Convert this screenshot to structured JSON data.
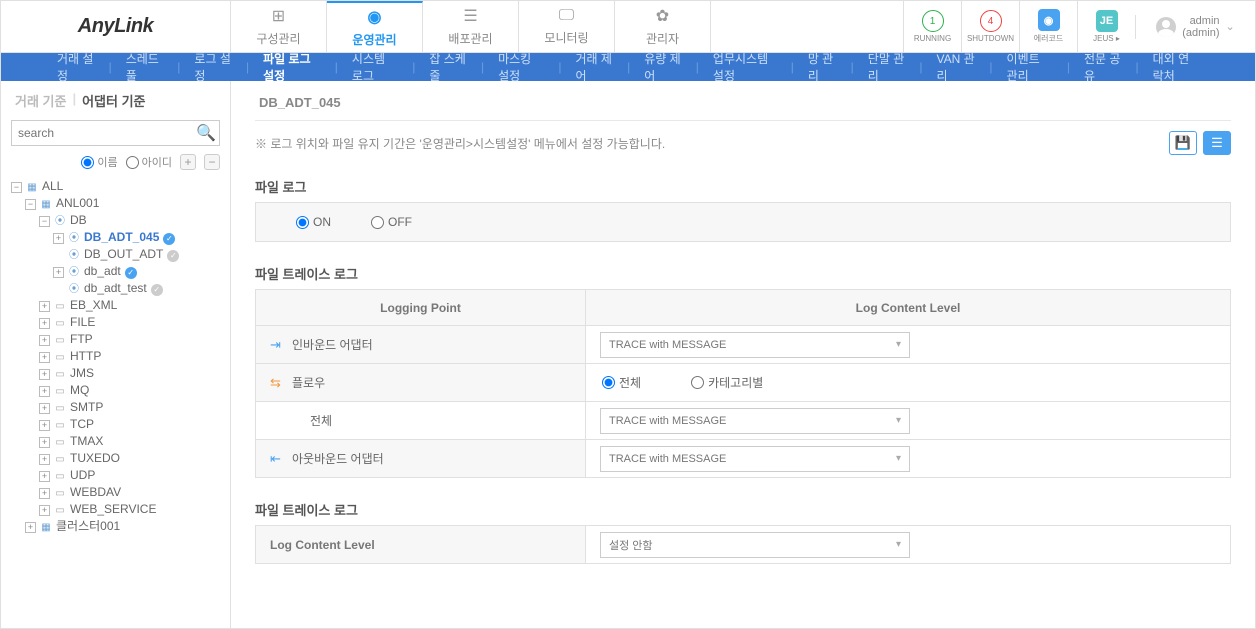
{
  "logo": "AnyLink",
  "topnav": [
    {
      "icon": "⊞",
      "label": "구성관리"
    },
    {
      "icon": "◉",
      "label": "운영관리"
    },
    {
      "icon": "☰",
      "label": "배포관리"
    },
    {
      "icon": "🖵",
      "label": "모니터링"
    },
    {
      "icon": "✿",
      "label": "관리자"
    }
  ],
  "status": {
    "running": {
      "count": "1",
      "label": "RUNNING"
    },
    "shutdown": {
      "count": "4",
      "label": "SHUTDOWN"
    },
    "errcode": {
      "badge": "◉",
      "label": "에러코드"
    },
    "jeus": {
      "badge": "JE",
      "label": "JEUS ▸"
    }
  },
  "user": {
    "name": "admin",
    "sub": "(admin)"
  },
  "subnav": [
    "거래 설정",
    "스레드 풀",
    "로그 설정",
    "파일 로그 설정",
    "시스템 로그",
    "잡 스케줄",
    "마스킹 설정",
    "거래 제어",
    "유량 제어",
    "업무시스템 설정",
    "망 관리",
    "단말 관리",
    "VAN 관리",
    "이벤트 관리",
    "전문 공유",
    "대외 연락처"
  ],
  "subnav_active": 3,
  "sidetabs": {
    "left": "거래 기준",
    "right": "어댑터 기준"
  },
  "search_placeholder": "search",
  "side_radios": {
    "name": "이름",
    "id": "아이디"
  },
  "tree": {
    "root": "ALL",
    "l1": "ANL001",
    "db": "DB",
    "db_children": [
      {
        "label": "DB_ADT_045",
        "check": "blue"
      },
      {
        "label": "DB_OUT_ADT",
        "check": "gray"
      },
      {
        "label": "db_adt",
        "check": "blue"
      },
      {
        "label": "db_adt_test",
        "check": "gray"
      }
    ],
    "others": [
      "EB_XML",
      "FILE",
      "FTP",
      "HTTP",
      "JMS",
      "MQ",
      "SMTP",
      "TCP",
      "TMAX",
      "TUXEDO",
      "UDP",
      "WEBDAV",
      "WEB_SERVICE"
    ],
    "cluster": "클러스터001"
  },
  "breadcrumb": "DB_ADT_045",
  "note": "※ 로그 위치와 파일 유지 기간은 '운영관리>시스템설정' 메뉴에서 설정 가능합니다.",
  "sections": {
    "filelog": {
      "title": "파일 로그",
      "on": "ON",
      "off": "OFF"
    },
    "trace": {
      "title": "파일 트레이스 로그",
      "col1": "Logging Point",
      "col2": "Log Content Level",
      "row_inbound": "인바운드 어댑터",
      "row_flow": "플로우",
      "flow_radio_all": "전체",
      "flow_radio_cat": "카테고리별",
      "row_flow_sub": "전체",
      "row_outbound": "아웃바운드 어댑터",
      "dd_value": "TRACE with MESSAGE"
    },
    "trace2": {
      "title": "파일 트레이스 로그",
      "label": "Log Content Level",
      "dd_value": "설정 안함"
    }
  }
}
